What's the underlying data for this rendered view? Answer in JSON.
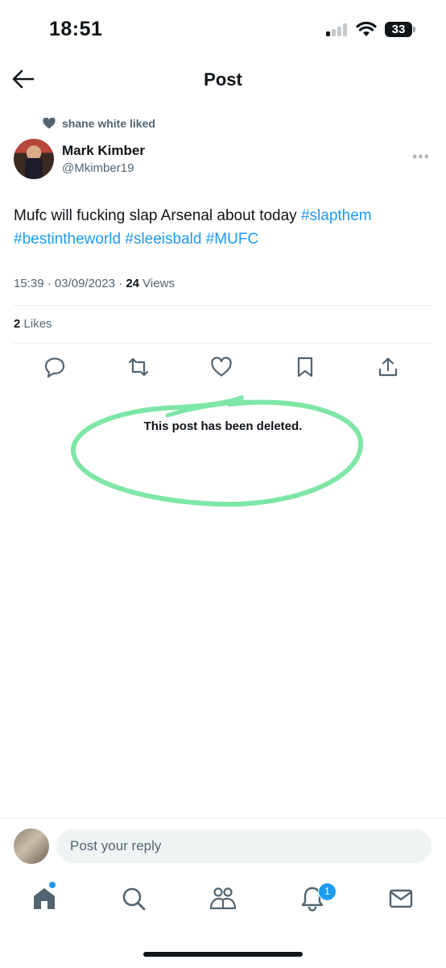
{
  "status_bar": {
    "time": "18:51",
    "battery": "33"
  },
  "header": {
    "title": "Post"
  },
  "social_context": {
    "text": "shane white liked"
  },
  "author": {
    "name": "Mark Kimber",
    "handle": "@Mkimber19"
  },
  "post": {
    "text": "Mufc will fucking slap Arsenal about today",
    "hashtags": [
      "#slapthem",
      "#bestintheworld",
      "#sleeisbald",
      "#MUFC"
    ],
    "time": "15:39",
    "date": "03/09/2023",
    "views_count": "24",
    "views_label": "Views",
    "likes_count": "2",
    "likes_label": "Likes"
  },
  "annotation": {
    "text": "This post has been deleted.",
    "highlight_color": "#7ee6a6"
  },
  "reply": {
    "placeholder": "Post your reply"
  },
  "tab_bar": {
    "notifications_badge": "1"
  },
  "colors": {
    "accent": "#1d9bf0",
    "text": "#0f1419",
    "secondary": "#536471"
  }
}
